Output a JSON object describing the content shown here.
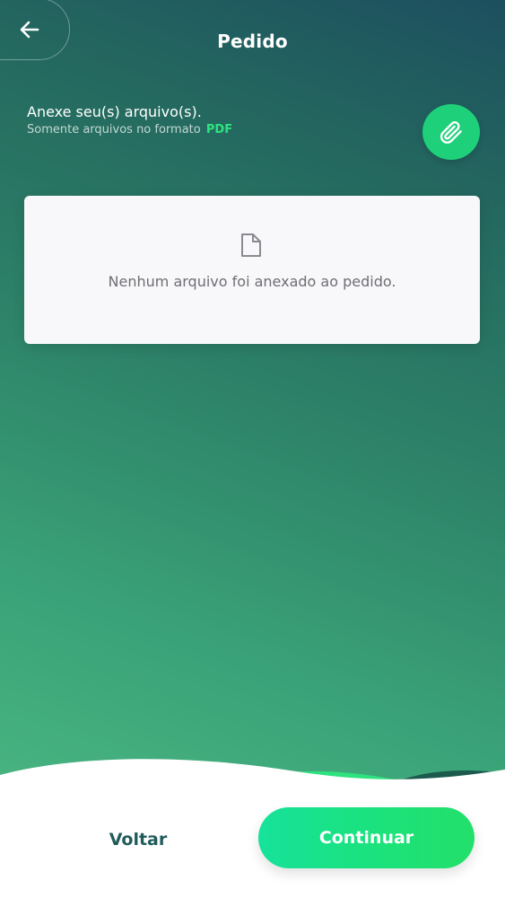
{
  "header": {
    "title": "Pedido",
    "back_icon": "arrow-left-icon"
  },
  "attach": {
    "heading": "Anexe seu(s) arquivo(s).",
    "subtitle_prefix": "Somente arquivos no formato",
    "subtitle_format": "PDF",
    "button_icon": "paperclip-icon"
  },
  "files": {
    "items": [],
    "empty_icon": "file-icon",
    "empty_message": "Nenhum arquivo foi anexado ao pedido."
  },
  "footer": {
    "back_label": "Voltar",
    "continue_label": "Continuar"
  },
  "colors": {
    "accent": "#1fd07a",
    "pdf_highlight": "#2ee37f",
    "gradient_top": "#1d4f5f",
    "gradient_bottom": "#4fbd85",
    "voltar_text": "#1f5b5a"
  }
}
